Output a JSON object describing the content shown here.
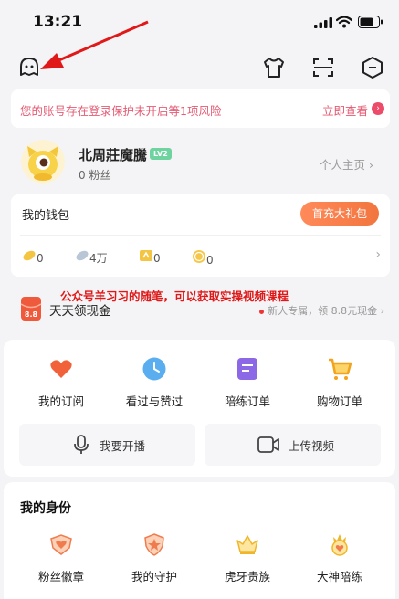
{
  "status_bar": {
    "time": "13:21"
  },
  "risk_banner": {
    "text": "您的账号存在登录保护未开启等1项风险",
    "link": "立即查看",
    "arrow": "›"
  },
  "profile": {
    "name": "北周莊魔騰",
    "level": "LV2",
    "fans": "0 粉丝",
    "home_link": "个人主页 ›"
  },
  "wallet": {
    "title": "我的钱包",
    "recharge_button": "首充大礼包",
    "assets": [
      {
        "icon": "gold-bean-icon",
        "value": "0"
      },
      {
        "icon": "silver-bean-icon",
        "value": "4万"
      },
      {
        "icon": "coupon-icon",
        "value": "0"
      },
      {
        "icon": "coin-icon",
        "value": "0"
      }
    ],
    "more": "›"
  },
  "promo_text": "公众号羊习习的随笔，可以获取实操视频课程",
  "daily_cash": {
    "title": "天天领现金",
    "badge": "8.8",
    "right_text": "新人专属，领 8.8元现金 ›"
  },
  "menu": {
    "items": [
      {
        "label": "我的订阅",
        "icon": "heart-icon"
      },
      {
        "label": "看过与赞过",
        "icon": "clock-icon"
      },
      {
        "label": "陪练订单",
        "icon": "order-icon"
      },
      {
        "label": "购物订单",
        "icon": "cart-icon"
      }
    ],
    "actions": [
      {
        "label": "我要开播",
        "icon": "microphone-icon"
      },
      {
        "label": "上传视频",
        "icon": "video-camera-icon"
      }
    ]
  },
  "identity": {
    "title": "我的身份",
    "items": [
      {
        "label": "粉丝徽章",
        "icon": "fan-badge-icon"
      },
      {
        "label": "我的守护",
        "icon": "guard-icon"
      },
      {
        "label": "虎牙贵族",
        "icon": "crown-icon"
      },
      {
        "label": "大神陪练",
        "icon": "master-icon"
      }
    ]
  },
  "colors": {
    "accent": "#ec4c6a",
    "recharge": "#f2753e",
    "promo": "#e01818",
    "arrow": "#e01818"
  }
}
